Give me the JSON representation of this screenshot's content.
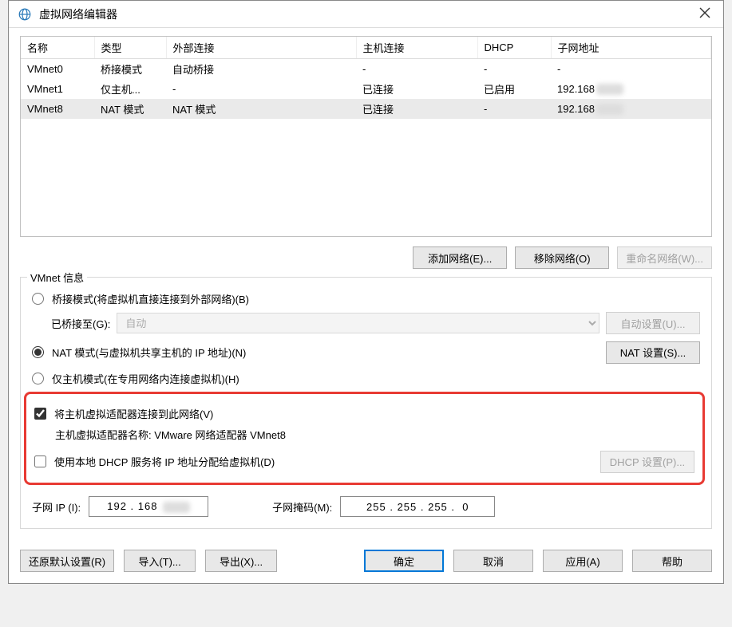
{
  "title": "虚拟网络编辑器",
  "table": {
    "headers": [
      "名称",
      "类型",
      "外部连接",
      "主机连接",
      "DHCP",
      "子网地址"
    ],
    "rows": [
      {
        "name": "VMnet0",
        "type": "桥接模式",
        "ext": "自动桥接",
        "host": "-",
        "dhcp": "-",
        "subnet": "-",
        "selected": false
      },
      {
        "name": "VMnet1",
        "type": "仅主机...",
        "ext": "-",
        "host": "已连接",
        "dhcp": "已启用",
        "subnet": "192.168",
        "selected": false,
        "blur": true
      },
      {
        "name": "VMnet8",
        "type": "NAT 模式",
        "ext": "NAT 模式",
        "host": "已连接",
        "dhcp": "-",
        "subnet": "192.168",
        "selected": true,
        "blur": true
      }
    ]
  },
  "buttons": {
    "add": "添加网络(E)...",
    "remove": "移除网络(O)",
    "rename": "重命名网络(W)...",
    "auto_set": "自动设置(U)...",
    "nat_set": "NAT 设置(S)...",
    "dhcp_set": "DHCP 设置(P)...",
    "restore": "还原默认设置(R)",
    "import": "导入(T)...",
    "export": "导出(X)...",
    "ok": "确定",
    "cancel": "取消",
    "apply": "应用(A)",
    "help": "帮助"
  },
  "fieldset": {
    "label": "VMnet 信息",
    "bridge_label": "桥接模式(将虚拟机直接连接到外部网络)(B)",
    "bridged_to_label": "已桥接至(G):",
    "bridged_to_value": "自动",
    "nat_label": "NAT 模式(与虚拟机共享主机的 IP 地址)(N)",
    "hostonly_label": "仅主机模式(在专用网络内连接虚拟机)(H)",
    "connect_adapter_label": "将主机虚拟适配器连接到此网络(V)",
    "adapter_name_label": "主机虚拟适配器名称: VMware 网络适配器 VMnet8",
    "dhcp_label": "使用本地 DHCP 服务将 IP 地址分配给虚拟机(D)",
    "subnet_ip_label": "子网 IP (I):",
    "subnet_ip_value": "192 . 168",
    "subnet_mask_label": "子网掩码(M):",
    "subnet_mask_value": "255 . 255 . 255 .  0"
  }
}
